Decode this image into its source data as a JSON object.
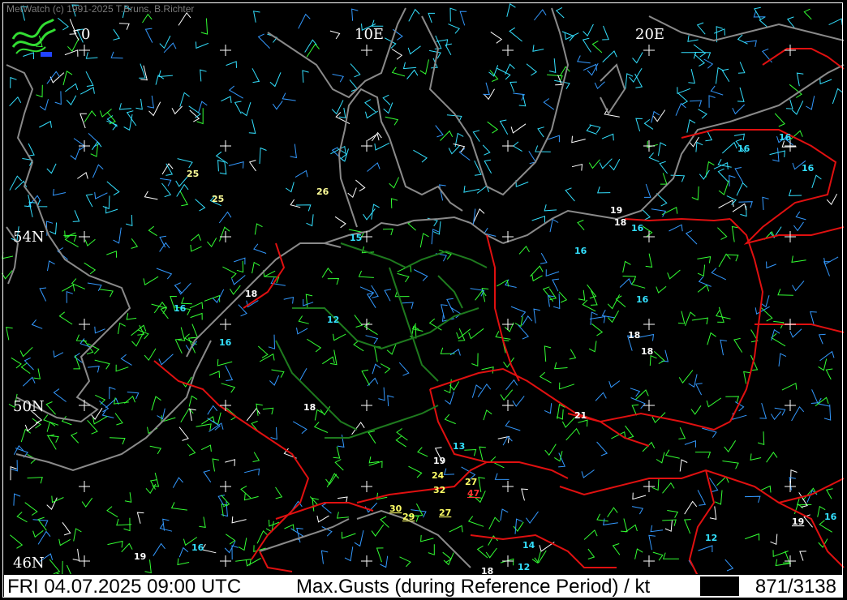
{
  "app": {
    "copyright": "MetWatch  (c) 1991-2025 T.Bruns, B.Richter"
  },
  "status": {
    "datetime": "FRI 04.07.2025 09:00 UTC",
    "parameter": "Max.Gusts (during Reference Period) / kt",
    "counter": "871/3138"
  },
  "map": {
    "background": "#000000",
    "coastline_color": "#8a8a8a",
    "border_color": "#e01010",
    "germany_border_color": "#1e7a1e",
    "graticule_color": "#ffffff",
    "longitude_labels": [
      "0",
      "10E",
      "20E"
    ],
    "latitude_labels": [
      "54N",
      "50N",
      "46N"
    ]
  },
  "gust_labels": [
    {
      "text": "25",
      "color": "#ffff99",
      "underline": false
    },
    {
      "text": "25",
      "color": "#ffff99",
      "underline": false
    },
    {
      "text": "26",
      "color": "#ffff99",
      "underline": false
    },
    {
      "text": "15",
      "color": "#33e0ff",
      "underline": false
    },
    {
      "text": "18",
      "color": "#ffffff",
      "underline": false
    },
    {
      "text": "16",
      "color": "#33e0ff",
      "underline": false
    },
    {
      "text": "12",
      "color": "#33e0ff",
      "underline": false
    },
    {
      "text": "16",
      "color": "#33e0ff",
      "underline": false
    },
    {
      "text": "18",
      "color": "#ffffff",
      "underline": false
    },
    {
      "text": "19",
      "color": "#ffffff",
      "underline": false
    },
    {
      "text": "18",
      "color": "#ffffff",
      "underline": false
    },
    {
      "text": "16",
      "color": "#33e0ff",
      "underline": false
    },
    {
      "text": "16",
      "color": "#33e0ff",
      "underline": false
    },
    {
      "text": "16",
      "color": "#33e0ff",
      "underline": false
    },
    {
      "text": "16",
      "color": "#33e0ff",
      "underline": false
    },
    {
      "text": "16",
      "color": "#33e0ff",
      "underline": false
    },
    {
      "text": "16",
      "color": "#33e0ff",
      "underline": false
    },
    {
      "text": "18",
      "color": "#ffffff",
      "underline": false
    },
    {
      "text": "18",
      "color": "#ffffff",
      "underline": false
    },
    {
      "text": "21",
      "color": "#ffffff",
      "underline": false
    },
    {
      "text": "13",
      "color": "#33e0ff",
      "underline": false
    },
    {
      "text": "19",
      "color": "#ffffff",
      "underline": false
    },
    {
      "text": "24",
      "color": "#ffff66",
      "underline": false
    },
    {
      "text": "27",
      "color": "#ffff66",
      "underline": false
    },
    {
      "text": "32",
      "color": "#ffff66",
      "underline": false
    },
    {
      "text": "47",
      "color": "#ff3030",
      "underline": true
    },
    {
      "text": "30",
      "color": "#ffff66",
      "underline": true
    },
    {
      "text": "29",
      "color": "#ffff66",
      "underline": true
    },
    {
      "text": "27",
      "color": "#ffff66",
      "underline": true
    },
    {
      "text": "19",
      "color": "#ffffff",
      "underline": false
    },
    {
      "text": "16",
      "color": "#33e0ff",
      "underline": false
    },
    {
      "text": "14",
      "color": "#33e0ff",
      "underline": false
    },
    {
      "text": "12",
      "color": "#33e0ff",
      "underline": false
    },
    {
      "text": "12",
      "color": "#33e0ff",
      "underline": false
    },
    {
      "text": "18",
      "color": "#ffffff",
      "underline": false
    },
    {
      "text": "19",
      "color": "#ffffff",
      "underline": true
    },
    {
      "text": "16",
      "color": "#33e0ff",
      "underline": false
    }
  ],
  "barb_colors": [
    "#33ff33",
    "#3399ff",
    "#33e0ff",
    "#ffffff",
    "#ffff66"
  ]
}
